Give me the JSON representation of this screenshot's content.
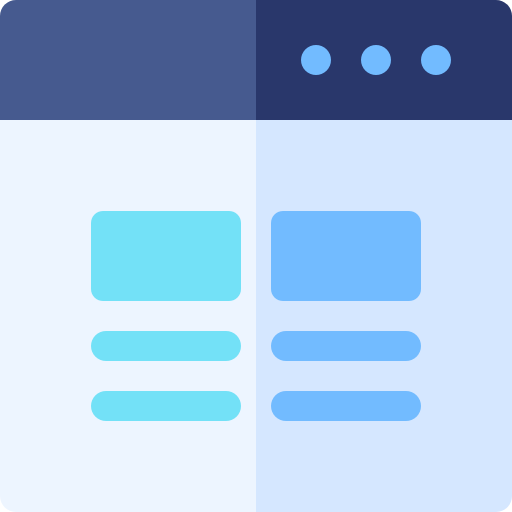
{
  "colors": {
    "titlebar_left": "#465a8f",
    "titlebar_right": "#29376b",
    "window_dots": "#72bbff",
    "pane_left_bg": "#edf5ff",
    "pane_right_bg": "#d5e7ff",
    "left_accent": "#73e1f7",
    "right_accent": "#72bbff"
  },
  "window_controls": {
    "dots": [
      {
        "icon": "dot-icon"
      },
      {
        "icon": "dot-icon"
      },
      {
        "icon": "dot-icon"
      }
    ]
  },
  "panes": [
    {
      "name": "left-pane",
      "card": "image-placeholder",
      "lines": 2
    },
    {
      "name": "right-pane",
      "card": "image-placeholder",
      "lines": 2
    }
  ]
}
